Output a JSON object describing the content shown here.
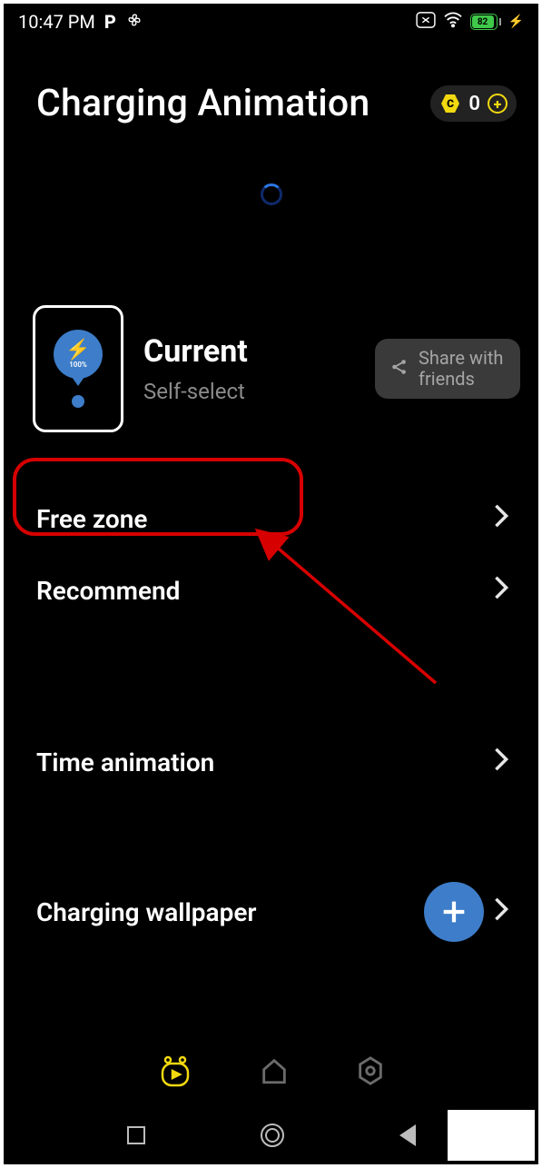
{
  "status": {
    "time": "10:47 PM",
    "p_icon": "P",
    "battery_pct": "82"
  },
  "header": {
    "title": "Charging Animation",
    "coin_letter": "C",
    "coin_count": "0"
  },
  "current": {
    "title": "Current",
    "subtitle": "Self-select",
    "preview_pct": "100%",
    "share_label": "Share with friends"
  },
  "menu": {
    "items": [
      {
        "label": "Free zone"
      },
      {
        "label": "Recommend"
      },
      {
        "label": "Time animation"
      },
      {
        "label": "Charging wallpaper"
      }
    ]
  }
}
